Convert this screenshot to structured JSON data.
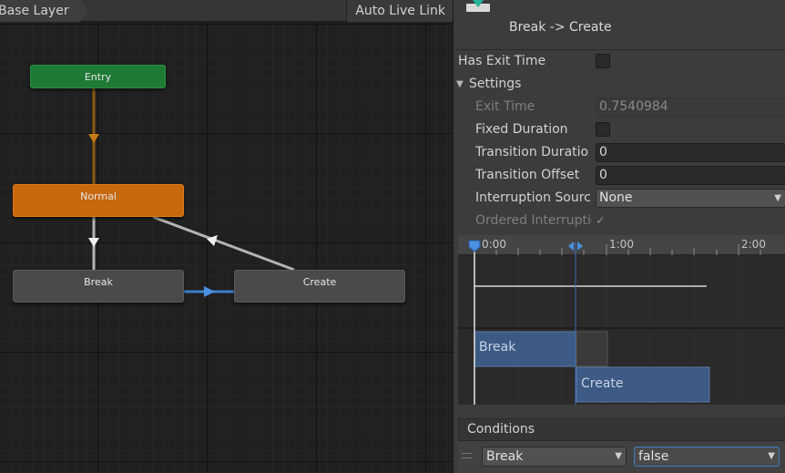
{
  "graph": {
    "layer_name": "Base Layer",
    "live_link_label": "Auto Live Link",
    "nodes": {
      "entry": "Entry",
      "normal": "Normal",
      "break": "Break",
      "create": "Create"
    }
  },
  "inspector": {
    "title": "Break -> Create",
    "has_exit_time": {
      "label": "Has Exit Time",
      "checked": false
    },
    "settings": {
      "label": "Settings",
      "exit_time": {
        "label": "Exit Time",
        "value": "0.7540984"
      },
      "fixed_duration": {
        "label": "Fixed Duration",
        "checked": false
      },
      "transition_duration": {
        "label": "Transition Duratio",
        "value": "0"
      },
      "transition_offset": {
        "label": "Transition Offset",
        "value": "0"
      },
      "interruption_source": {
        "label": "Interruption Sourc",
        "value": "None"
      },
      "ordered_interruption": {
        "label": "Ordered Interruptic",
        "checked": true
      }
    },
    "timeline": {
      "ticks": [
        "0:00",
        "1:00",
        "2:00"
      ],
      "source_state": "Break",
      "destination_state": "Create"
    },
    "conditions": {
      "label": "Conditions",
      "items": [
        {
          "parameter": "Break",
          "value": "false"
        }
      ]
    }
  },
  "colors": {
    "entry": "#1e7a34",
    "normal": "#c8680f",
    "state": "#4a4a4a",
    "selected_transition": "#4a90e2",
    "timeline_bar": "#3c5a84"
  }
}
